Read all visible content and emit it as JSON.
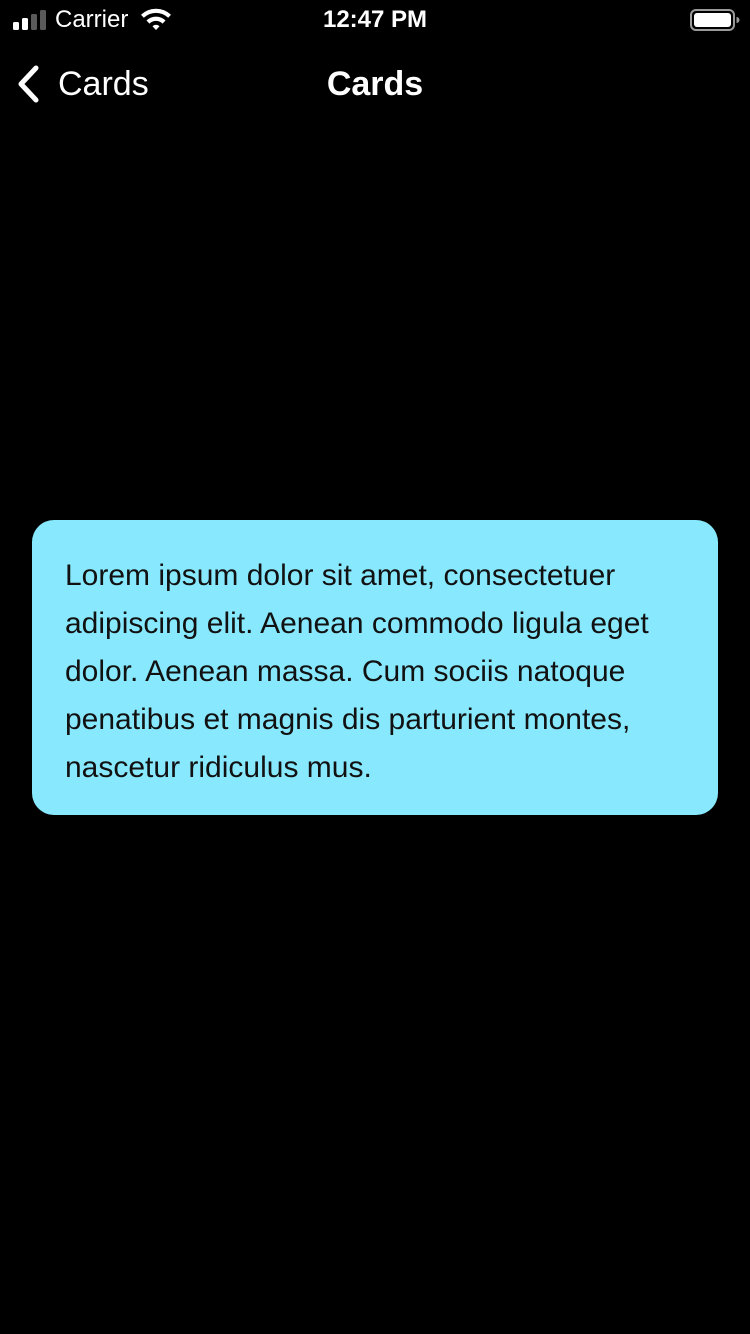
{
  "status_bar": {
    "carrier": "Carrier",
    "time": "12:47 PM"
  },
  "nav": {
    "back_label": "Cards",
    "title": "Cards"
  },
  "card": {
    "text": "Lorem ipsum dolor sit amet, consectetuer adipiscing elit. Aenean commodo ligula eget dolor. Aenean massa. Cum sociis natoque penatibus et magnis dis parturient montes, nascetur ridiculus mus.",
    "background_color": "#87e8fe"
  },
  "icons": {
    "signal": "cellular-signal-icon",
    "wifi": "wifi-icon",
    "battery": "battery-icon",
    "back": "chevron-left-icon"
  },
  "colors": {
    "background": "#000000",
    "foreground": "#ffffff"
  }
}
